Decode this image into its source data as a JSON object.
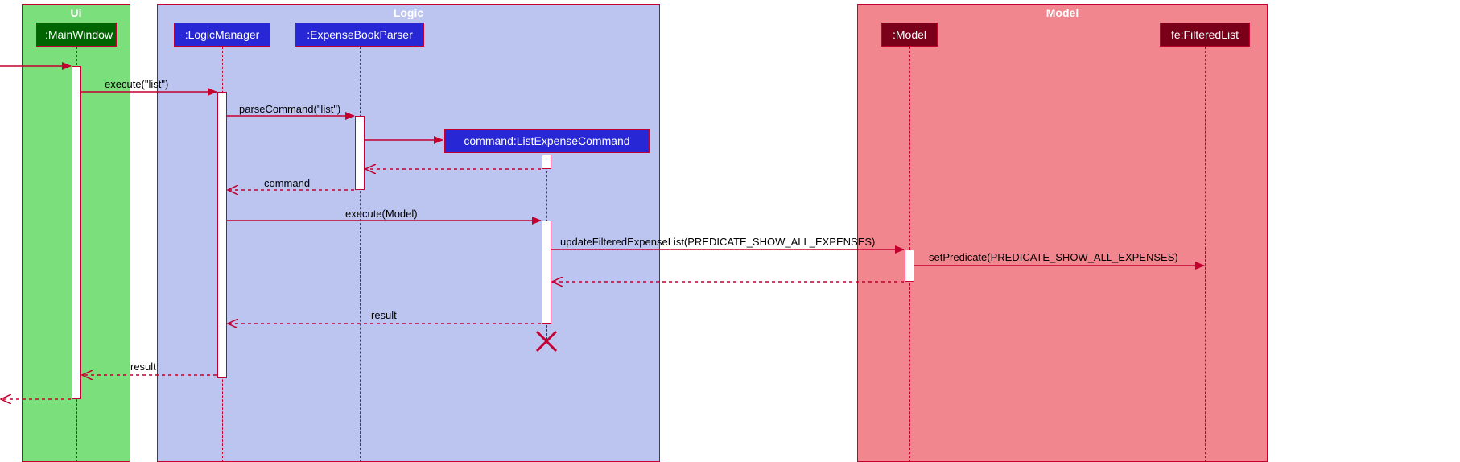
{
  "diagram_type": "UML Sequence Diagram",
  "boxes": {
    "ui": {
      "title": "Ui"
    },
    "logic": {
      "title": "Logic"
    },
    "model": {
      "title": "Model"
    }
  },
  "participants": {
    "main_window": {
      "label": ":MainWindow"
    },
    "logic_manager": {
      "label": ":LogicManager"
    },
    "expense_parser": {
      "label": ":ExpenseBookParser"
    },
    "list_cmd": {
      "label": "command:ListExpenseCommand"
    },
    "model": {
      "label": ":Model"
    },
    "filtered_list": {
      "label": "fe:FilteredList"
    }
  },
  "messages": {
    "m1": "execute(\"list\")",
    "m2": "parseCommand(\"list\")",
    "m3": "command",
    "m4": "execute(Model)",
    "m5": "updateFilteredExpenseList(PREDICATE_SHOW_ALL_EXPENSES)",
    "m6": "setPredicate(PREDICATE_SHOW_ALL_EXPENSES)",
    "m7": "result",
    "m8": "result"
  },
  "chart_data": {
    "type": "sequence_diagram",
    "boxes": [
      {
        "name": "Ui",
        "color": "#7be07b",
        "participants": [
          "MainWindow"
        ]
      },
      {
        "name": "Logic",
        "color": "#bcc4f0",
        "participants": [
          "LogicManager",
          "ExpenseBookParser",
          "ListExpenseCommand"
        ]
      },
      {
        "name": "Model",
        "color": "#f1868e",
        "participants": [
          "Model",
          "FilteredList"
        ]
      }
    ],
    "participants": [
      {
        "id": "MainWindow",
        "label": ":MainWindow",
        "header_color": "#006400"
      },
      {
        "id": "LogicManager",
        "label": ":LogicManager",
        "header_color": "#2727d6"
      },
      {
        "id": "ExpenseBookParser",
        "label": ":ExpenseBookParser",
        "header_color": "#2727d6"
      },
      {
        "id": "ListExpenseCommand",
        "label": "command:ListExpenseCommand",
        "header_color": "#2727d6",
        "created": true,
        "destroyed": true
      },
      {
        "id": "Model",
        "label": ":Model",
        "header_color": "#7a0019"
      },
      {
        "id": "FilteredList",
        "label": "fe:FilteredList",
        "header_color": "#7a0019"
      }
    ],
    "messages": [
      {
        "from": "external",
        "to": "MainWindow",
        "label": "",
        "kind": "sync"
      },
      {
        "from": "MainWindow",
        "to": "LogicManager",
        "label": "execute(\"list\")",
        "kind": "sync"
      },
      {
        "from": "LogicManager",
        "to": "ExpenseBookParser",
        "label": "parseCommand(\"list\")",
        "kind": "sync"
      },
      {
        "from": "ExpenseBookParser",
        "to": "ListExpenseCommand",
        "label": "",
        "kind": "create"
      },
      {
        "from": "ListExpenseCommand",
        "to": "ExpenseBookParser",
        "label": "",
        "kind": "return"
      },
      {
        "from": "ExpenseBookParser",
        "to": "LogicManager",
        "label": "command",
        "kind": "return"
      },
      {
        "from": "LogicManager",
        "to": "ListExpenseCommand",
        "label": "execute(Model)",
        "kind": "sync"
      },
      {
        "from": "ListExpenseCommand",
        "to": "Model",
        "label": "updateFilteredExpenseList(PREDICATE_SHOW_ALL_EXPENSES)",
        "kind": "sync"
      },
      {
        "from": "Model",
        "to": "FilteredList",
        "label": "setPredicate(PREDICATE_SHOW_ALL_EXPENSES)",
        "kind": "sync"
      },
      {
        "from": "Model",
        "to": "ListExpenseCommand",
        "label": "",
        "kind": "return"
      },
      {
        "from": "ListExpenseCommand",
        "to": "LogicManager",
        "label": "result",
        "kind": "return"
      },
      {
        "from": "LogicManager",
        "to": "MainWindow",
        "label": "result",
        "kind": "return"
      },
      {
        "from": "MainWindow",
        "to": "external",
        "label": "",
        "kind": "return"
      }
    ]
  }
}
